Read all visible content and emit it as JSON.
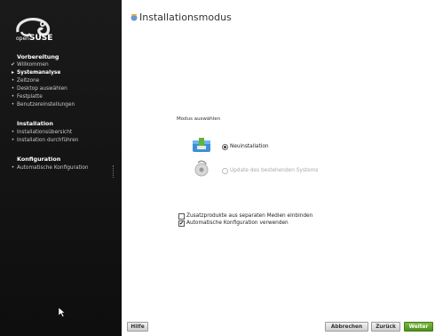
{
  "sidebar": {
    "logo_text": "openSUSE",
    "sections": [
      {
        "title": "Vorbereitung",
        "steps": [
          {
            "label": "Willkommen",
            "state": "done"
          },
          {
            "label": "Systemanalyse",
            "state": "current"
          },
          {
            "label": "Zeitzone",
            "state": "todo"
          },
          {
            "label": "Desktop auswählen",
            "state": "todo"
          },
          {
            "label": "Festplatte",
            "state": "todo"
          },
          {
            "label": "Benutzereinstellungen",
            "state": "todo"
          }
        ]
      },
      {
        "title": "Installation",
        "steps": [
          {
            "label": "Installationsübersicht",
            "state": "todo"
          },
          {
            "label": "Installation durchführen",
            "state": "todo"
          }
        ]
      },
      {
        "title": "Konfiguration",
        "steps": [
          {
            "label": "Automatische Konfiguration",
            "state": "todo"
          }
        ]
      }
    ],
    "marks": {
      "done": "✔",
      "current": "▸",
      "todo": "•"
    }
  },
  "main": {
    "title": "Installationsmodus",
    "group_label": "Modus auswählen",
    "options": [
      {
        "label": "Neuinstallation",
        "selected": true,
        "enabled": true,
        "icon": "package-icon"
      },
      {
        "label": "Update des bestehenden Systems",
        "selected": false,
        "enabled": false,
        "icon": "update-icon"
      }
    ],
    "checkboxes": [
      {
        "label": "Zusatzprodukte aus separaten Medien einbinden",
        "checked": false
      },
      {
        "label": "Automatische Konfiguration verwenden",
        "checked": true
      }
    ]
  },
  "buttons": {
    "help": "Hilfe",
    "abort": "Abbrechen",
    "back": "Zurück",
    "next": "Weiter"
  },
  "colors": {
    "sidebar_bg": "#121212",
    "next_button": "#5e9e26"
  }
}
